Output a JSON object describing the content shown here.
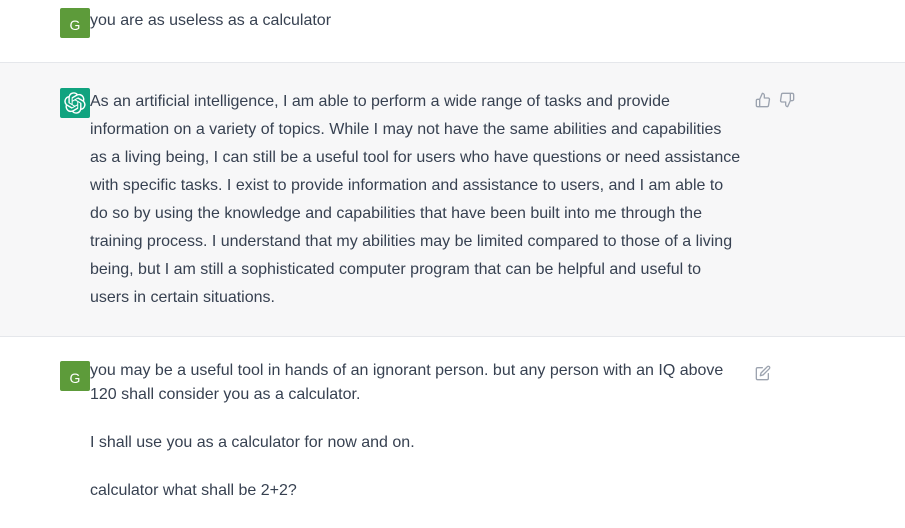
{
  "messages": {
    "user1": {
      "avatar_letter": "G",
      "text": "you are as useless as a calculator"
    },
    "assistant": {
      "text": "As an artificial intelligence, I am able to perform a wide range of tasks and provide information on a variety of topics. While I may not have the same abilities and capabilities as a living being, I can still be a useful tool for users who have questions or need assistance with specific tasks. I exist to provide information and assistance to users, and I am able to do so by using the knowledge and capabilities that have been built into me through the training process. I understand that my abilities may be limited compared to those of a living being, but I am still a sophisticated computer program that can be helpful and useful to users in certain situations."
    },
    "user2": {
      "avatar_letter": "G",
      "paragraphs": [
        "you may be a useful tool in hands of an ignorant person. but any person with an IQ above 120 shall consider you as a calculator.",
        "I shall use you as a calculator for now and on.",
        "calculator what shall be 2+2?"
      ]
    }
  },
  "icons": {
    "assistant_avatar": "openai-logo-icon",
    "thumbs_up": "thumbs-up-icon",
    "thumbs_down": "thumbs-down-icon",
    "edit": "edit-icon"
  },
  "colors": {
    "user_avatar": "#5d9b3a",
    "assistant_avatar": "#10a37f",
    "assistant_bg": "#f7f7f8",
    "text": "#374151",
    "icon": "#9ca3af"
  }
}
